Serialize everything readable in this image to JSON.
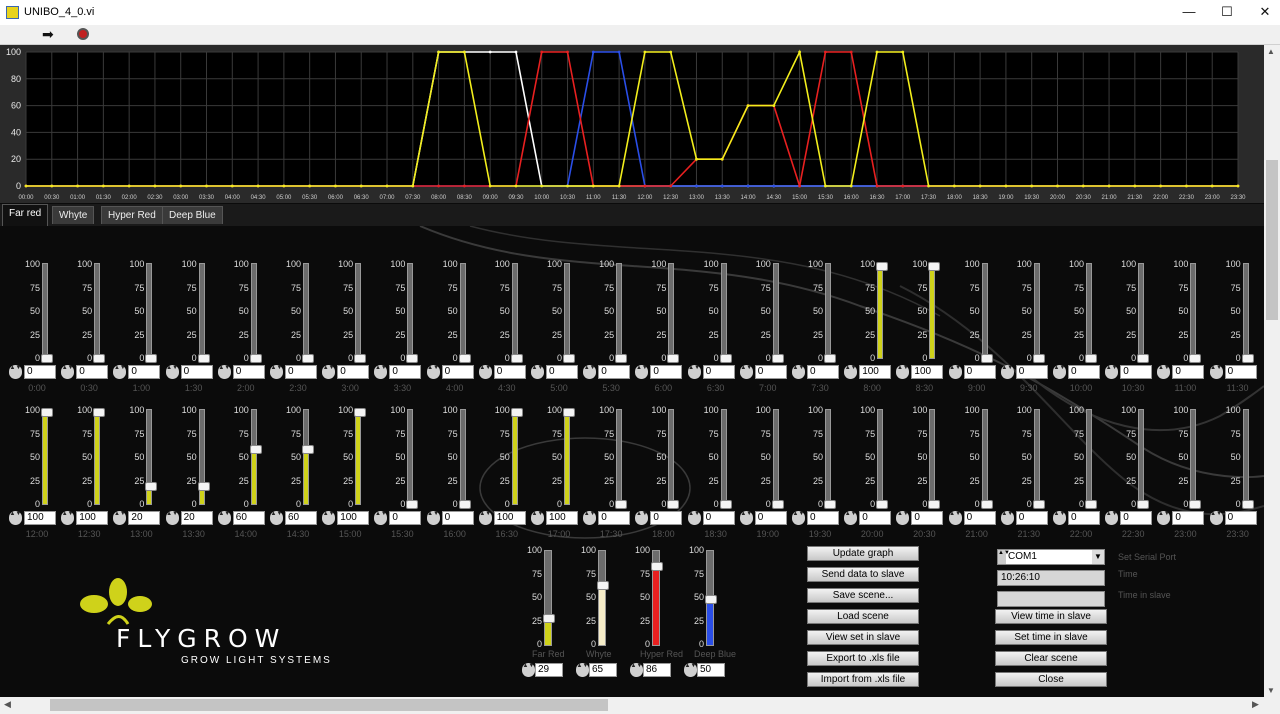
{
  "window": {
    "title": "UNIBO_4_0.vi",
    "minimize": "—",
    "maximize": "☐",
    "close": "✕"
  },
  "toolbar": {
    "run_icon": "run-arrow-icon",
    "stop_icon": "abort-stop-icon"
  },
  "chart_data": {
    "type": "line",
    "y_ticks": [
      "0",
      "20",
      "40",
      "60",
      "80",
      "100"
    ],
    "ylim": [
      0,
      100
    ],
    "x_ticks": [
      "00:00",
      "00:30",
      "01:00",
      "01:30",
      "02:00",
      "02:30",
      "03:00",
      "03:30",
      "04:00",
      "04:30",
      "05:00",
      "05:30",
      "06:00",
      "06:30",
      "07:00",
      "07:30",
      "08:00",
      "08:30",
      "09:00",
      "09:30",
      "10:00",
      "10:30",
      "11:00",
      "11:30",
      "12:00",
      "12:30",
      "13:00",
      "13:30",
      "14:00",
      "14:30",
      "15:00",
      "15:30",
      "16:00",
      "16:30",
      "17:00",
      "17:30",
      "18:00",
      "18:30",
      "19:00",
      "19:30",
      "20:00",
      "20:30",
      "21:00",
      "21:30",
      "22:00",
      "22:30",
      "23:00",
      "23:30"
    ],
    "grid": true,
    "series": [
      {
        "name": "Whyte",
        "color": "#ffffff",
        "values": [
          0,
          0,
          0,
          0,
          0,
          0,
          0,
          0,
          0,
          0,
          0,
          0,
          0,
          0,
          0,
          0,
          100,
          100,
          100,
          100,
          0,
          0,
          0,
          0,
          0,
          0,
          0,
          0,
          0,
          0,
          0,
          0,
          0,
          0,
          0,
          0,
          0,
          0,
          0,
          0,
          0,
          0,
          0,
          0,
          0,
          0,
          0,
          0
        ]
      },
      {
        "name": "Deep Blue",
        "color": "#2a4ee8",
        "values": [
          0,
          0,
          0,
          0,
          0,
          0,
          0,
          0,
          0,
          0,
          0,
          0,
          0,
          0,
          0,
          0,
          0,
          0,
          0,
          0,
          0,
          0,
          100,
          100,
          0,
          0,
          0,
          0,
          0,
          0,
          0,
          0,
          0,
          0,
          0,
          0,
          0,
          0,
          0,
          0,
          0,
          0,
          0,
          0,
          0,
          0,
          0,
          0
        ]
      },
      {
        "name": "Hyper Red",
        "color": "#e82020",
        "values": [
          0,
          0,
          0,
          0,
          0,
          0,
          0,
          0,
          0,
          0,
          0,
          0,
          0,
          0,
          0,
          0,
          0,
          0,
          0,
          0,
          100,
          100,
          0,
          0,
          0,
          0,
          20,
          20,
          60,
          60,
          0,
          100,
          100,
          0,
          0,
          0,
          0,
          0,
          0,
          0,
          0,
          0,
          0,
          0,
          0,
          0,
          0,
          0
        ]
      },
      {
        "name": "Far red",
        "color": "#f2ee1c",
        "values": [
          0,
          0,
          0,
          0,
          0,
          0,
          0,
          0,
          0,
          0,
          0,
          0,
          0,
          0,
          0,
          0,
          100,
          100,
          0,
          0,
          0,
          0,
          0,
          0,
          100,
          100,
          20,
          20,
          60,
          60,
          100,
          0,
          0,
          100,
          100,
          0,
          0,
          0,
          0,
          0,
          0,
          0,
          0,
          0,
          0,
          0,
          0,
          0
        ]
      }
    ]
  },
  "tabs": [
    "Far red",
    "Whyte",
    "Hyper Red",
    "Deep Blue"
  ],
  "slider_ticks": [
    "100",
    "75",
    "50",
    "25",
    "0"
  ],
  "spin_glyph": "▲▼",
  "row1": {
    "labels": [
      "0:00",
      "0:30",
      "1:00",
      "1:30",
      "2:00",
      "2:30",
      "3:00",
      "3:30",
      "4:00",
      "4:30",
      "5:00",
      "5:30",
      "6:00",
      "6:30",
      "7:00",
      "7:30",
      "8:00",
      "8:30",
      "9:00",
      "9:30",
      "10:00",
      "10:30",
      "11:00",
      "11:30"
    ],
    "values": [
      0,
      0,
      0,
      0,
      0,
      0,
      0,
      0,
      0,
      0,
      0,
      0,
      0,
      0,
      0,
      0,
      100,
      100,
      0,
      0,
      0,
      0,
      0,
      0
    ]
  },
  "row2": {
    "labels": [
      "12:00",
      "12:30",
      "13:00",
      "13:30",
      "14:00",
      "14:30",
      "15:00",
      "15:30",
      "16:00",
      "16:30",
      "17:00",
      "17:30",
      "18:00",
      "18:30",
      "19:00",
      "19:30",
      "20:00",
      "20:30",
      "21:00",
      "21:30",
      "22:00",
      "22:30",
      "23:00",
      "23:30"
    ],
    "values": [
      100,
      100,
      20,
      20,
      60,
      60,
      100,
      0,
      0,
      100,
      100,
      0,
      0,
      0,
      0,
      0,
      0,
      0,
      0,
      0,
      0,
      0,
      0,
      0
    ]
  },
  "channels": [
    {
      "name": "Far Red",
      "value": "29",
      "level": 29,
      "color": "#cfd21a"
    },
    {
      "name": "Whyte",
      "value": "65",
      "level": 65,
      "color": "#f5ecc8"
    },
    {
      "name": "Hyper  Red",
      "value": "86",
      "level": 86,
      "color": "#e82020"
    },
    {
      "name": "Deep Blue",
      "value": "50",
      "level": 50,
      "color": "#2a4ee8"
    }
  ],
  "buttons_left": [
    "Update graph",
    "Send data to slave",
    "Save scene...",
    "Load scene",
    "View set in slave",
    "Export to .xls file",
    "Import from .xls file"
  ],
  "serial": {
    "port": "COM1",
    "port_label": "Set Serial Port",
    "time": "10:26:10",
    "time_label": "Time",
    "time_slave": "",
    "time_slave_label": "Time in slave"
  },
  "buttons_right": [
    "View time in slave",
    "Set time in slave",
    "Clear scene",
    "Close"
  ],
  "logo": {
    "brand": "FLYGROW",
    "tagline": "GROW LIGHT SYSTEMS"
  }
}
